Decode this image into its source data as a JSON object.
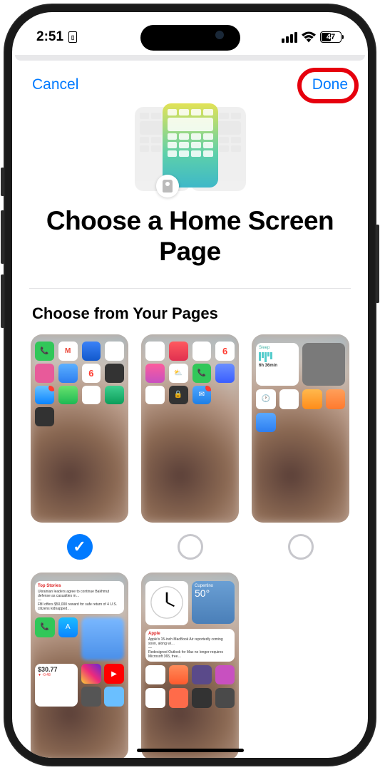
{
  "status": {
    "time": "2:51",
    "battery_pct": "47"
  },
  "nav": {
    "cancel": "Cancel",
    "done": "Done"
  },
  "title": "Choose a Home Screen Page",
  "section_label": "Choose from Your Pages",
  "pages": [
    {
      "selected": true
    },
    {
      "selected": false
    },
    {
      "selected": false
    },
    {
      "selected": false
    },
    {
      "selected": false
    }
  ],
  "colors": {
    "accent": "#007aff",
    "highlight_ring": "#e6000d"
  },
  "thumb3_widgets": {
    "sleep": "Sleep",
    "time": "6h 36min"
  },
  "thumb4_widgets": {
    "header": "Top Stories",
    "price": "$30.77"
  },
  "thumb5_widgets": {
    "temp": "50°",
    "city": "Cupertino",
    "section": "Apple"
  }
}
